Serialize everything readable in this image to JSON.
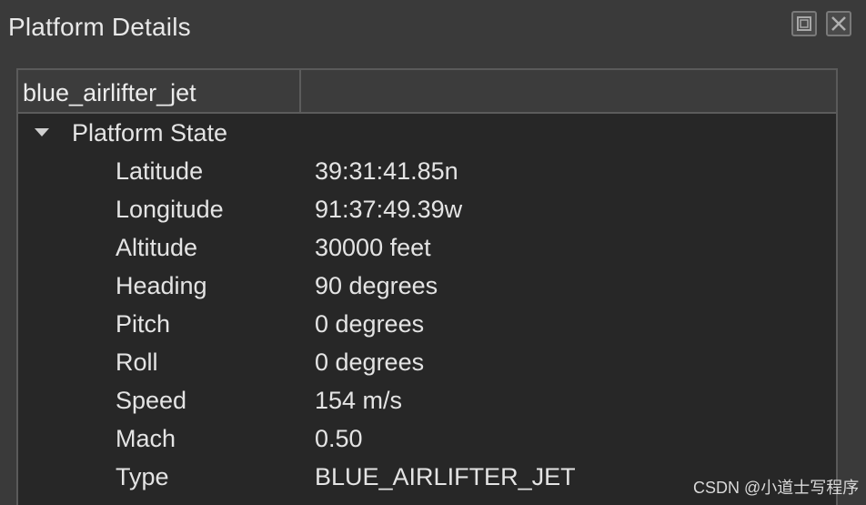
{
  "panel": {
    "title": "Platform Details",
    "buttons": {
      "float_icon": "float-window-icon",
      "close_icon": "close-window-icon"
    }
  },
  "tree": {
    "header": {
      "columns": [
        "blue_airlifter_jet",
        ""
      ]
    },
    "group": {
      "label": "Platform State",
      "expanded": true,
      "rows": [
        {
          "label": "Latitude",
          "value": "39:31:41.85n"
        },
        {
          "label": "Longitude",
          "value": "91:37:49.39w"
        },
        {
          "label": "Altitude",
          "value": "30000 feet"
        },
        {
          "label": "Heading",
          "value": "90 degrees"
        },
        {
          "label": "Pitch",
          "value": "0 degrees"
        },
        {
          "label": "Roll",
          "value": "0 degrees"
        },
        {
          "label": "Speed",
          "value": "154 m/s"
        },
        {
          "label": "Mach",
          "value": "0.50"
        },
        {
          "label": "Type",
          "value": "BLUE_AIRLIFTER_JET"
        }
      ]
    }
  },
  "watermark": "CSDN @小道士写程序",
  "colors": {
    "panel_background": "#3a3a3a",
    "tree_background": "#272727",
    "header_background": "#3c3c3c",
    "text": "#e4e4e4"
  }
}
